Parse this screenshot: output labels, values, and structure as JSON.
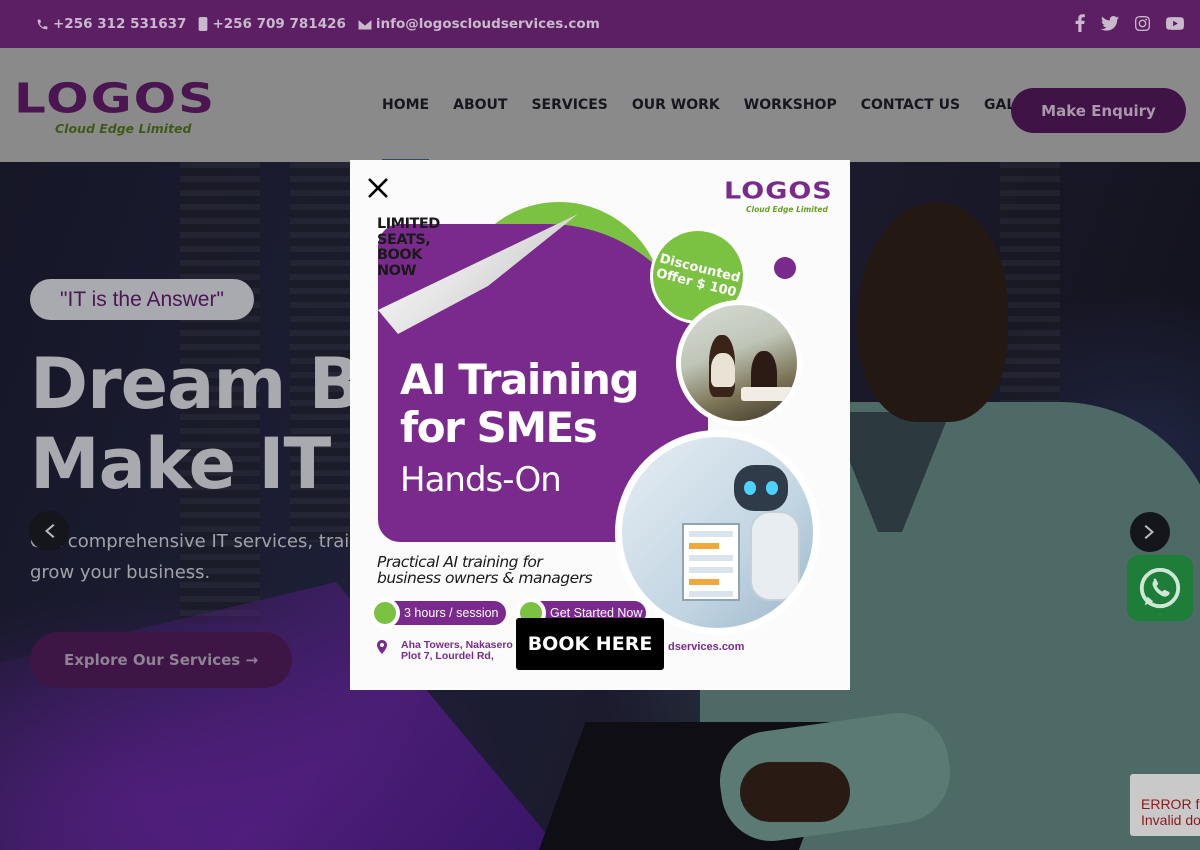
{
  "topbar": {
    "phone1": "+256 312 531637",
    "phone2": "+256 709 781426",
    "email": "info@logoscloudservices.com",
    "social": [
      "facebook-icon",
      "twitter-icon",
      "instagram-icon",
      "youtube-icon"
    ]
  },
  "brand": {
    "name": "LOGOS",
    "tagline": "Cloud Edge Limited",
    "colors": {
      "purple": "#5c1f63",
      "green": "#7cc242",
      "accent_purple": "#7a2a8c"
    }
  },
  "nav": {
    "items": [
      "HOME",
      "ABOUT",
      "SERVICES",
      "OUR WORK",
      "WORKSHOP",
      "CONTACT US",
      "GALLERY"
    ],
    "active": "HOME",
    "cta": "Make Enquiry"
  },
  "hero": {
    "badge": "\"IT is the Answer\"",
    "title_line1": "Dream Big,",
    "title_line2": "Make IT Possible",
    "description_line1": "Get comprehensive IT services, training",
    "description_line2": "grow your business.",
    "cta": "Explore Our Services →"
  },
  "popup": {
    "logo_word": "LOGOS",
    "logo_sub": "Cloud Edge Limited",
    "limited": [
      "LIMITED",
      "SEATS,",
      "BOOK",
      "NOW"
    ],
    "discount_line1": "Discounted",
    "discount_line2": "Offer $ 100",
    "title_line1": "AI Training",
    "title_line2": "for SMEs",
    "subtitle": "Hands-On",
    "practical_line1": "Practical AI training for",
    "practical_line2": "business owners & managers",
    "chip1": "3 hours / session",
    "chip2": "Get Started Now",
    "address_line1": "Aha Towers, Nakasero",
    "address_line2": "Plot 7, Lourdel Rd,",
    "email_partial": "dservices.com",
    "book_button": "BOOK HERE"
  },
  "recaptcha": {
    "line1": "ERROR fo",
    "line2": "Invalid do"
  }
}
